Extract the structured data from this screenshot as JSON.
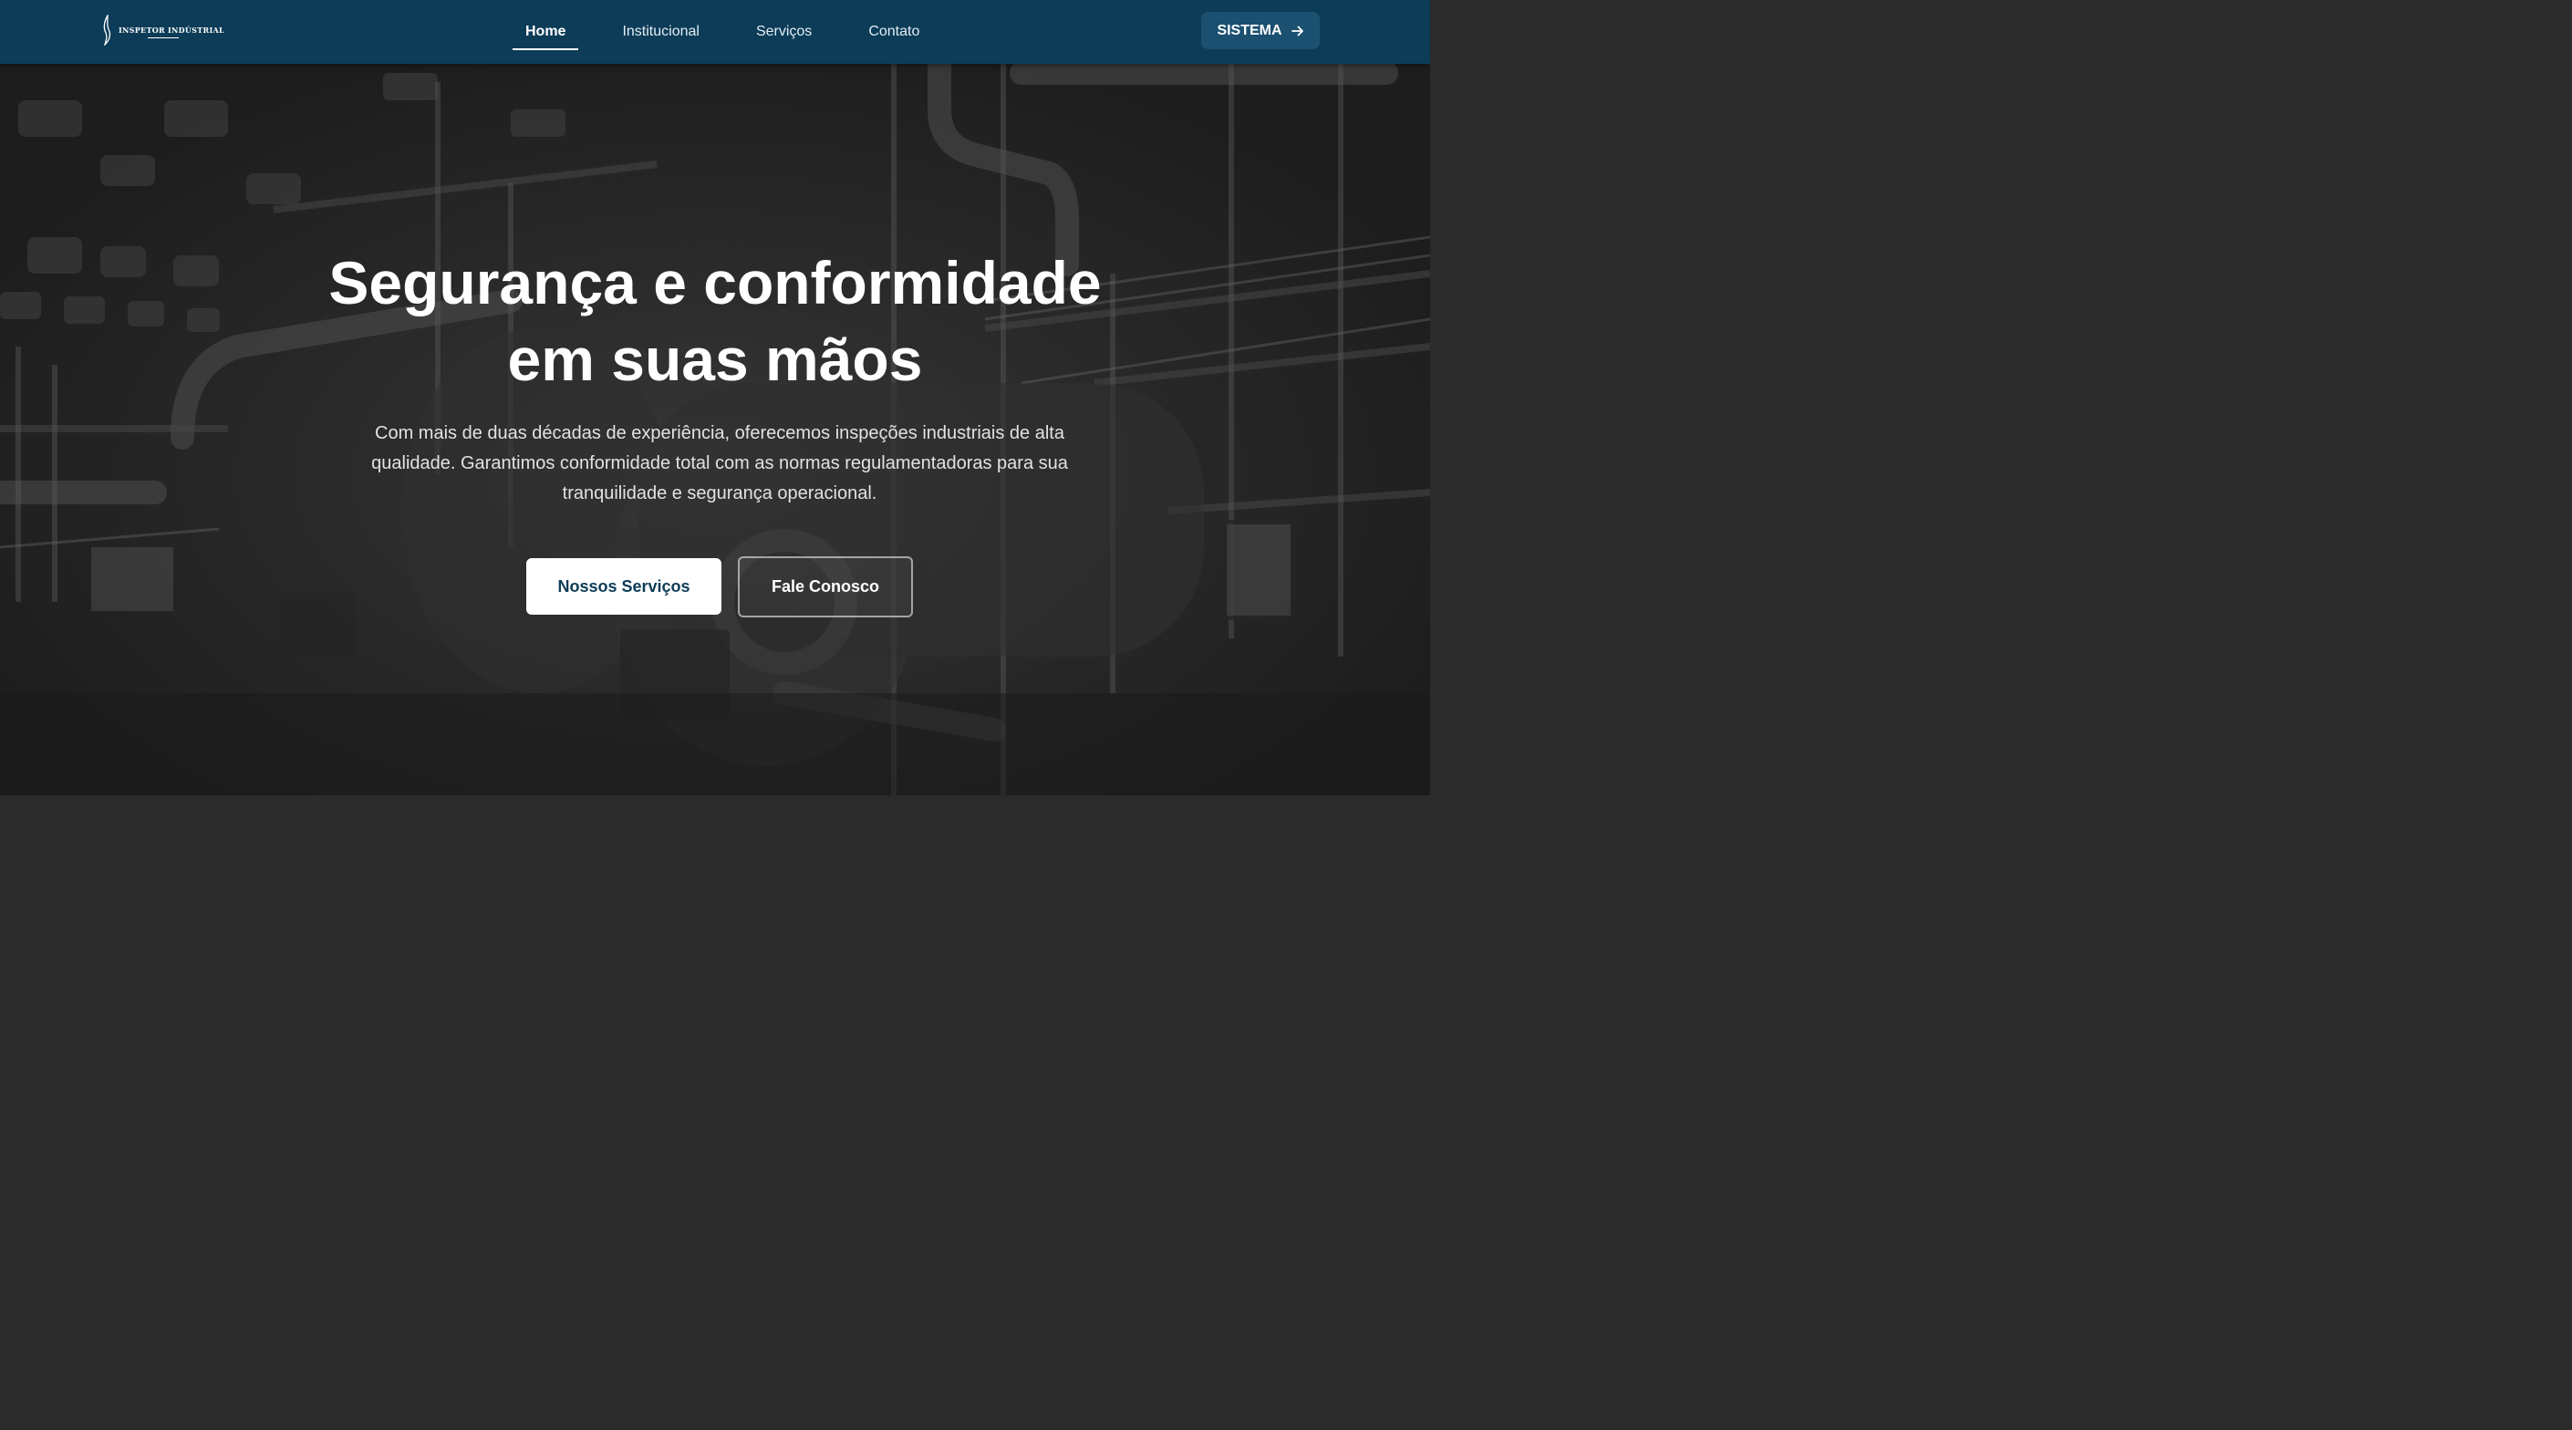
{
  "header": {
    "logo_text": "INSPETOR INDÚSTRIAL",
    "background_color": "#0c3c57",
    "nav": [
      {
        "label": "Home",
        "active": true
      },
      {
        "label": "Institucional",
        "active": false
      },
      {
        "label": "Serviços",
        "active": false
      },
      {
        "label": "Contato",
        "active": false
      }
    ],
    "sistema_label": "SISTEMA",
    "sistema_icon": "arrow-right-icon"
  },
  "hero": {
    "title_line1": "Segurança e conformidade",
    "title_line2": "em suas mãos",
    "subtitle": "Com mais de duas décadas de experiência, oferecemos inspeções industriais de alta qualidade. Garantimos conformidade total com as normas regulamentadoras para sua tranquilidade e segurança operacional.",
    "primary_button": "Nossos Serviços",
    "secondary_button": "Fale Conosco",
    "background_image": "industrial boiler room (grayscale)"
  }
}
